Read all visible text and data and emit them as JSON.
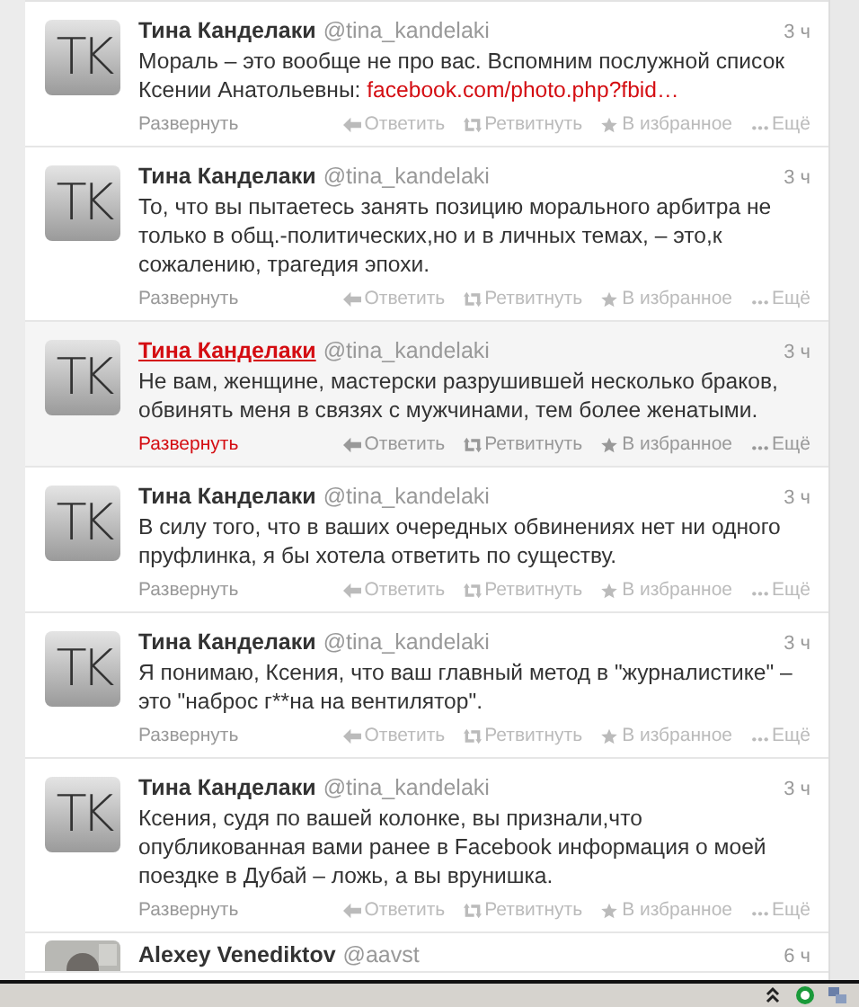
{
  "tweets": [
    {
      "kind": "logo",
      "avatar": "TK",
      "name": "Тина Канделаки",
      "handle": "@tina_kandelaki",
      "time": "3 ч",
      "text": "Мораль – это вообще не про вас. Вспомним послужной список Ксении Анатольевны: ",
      "link": "facebook.com/photo.php?fbid…",
      "expand": "Развернуть",
      "hovered": false,
      "actions": [
        "Ответить",
        "Ретвитнуть",
        "В избранное",
        "Ещё"
      ]
    },
    {
      "kind": "logo",
      "avatar": "TK",
      "name": "Тина Канделаки",
      "handle": "@tina_kandelaki",
      "time": "3 ч",
      "text": "То, что вы пытаетесь занять позицию морального арбитра не только в общ.-политических,но и в личных темах, – это,к сожалению, трагедия эпохи.",
      "expand": "Развернуть",
      "hovered": false,
      "actions": [
        "Ответить",
        "Ретвитнуть",
        "В избранное",
        "Ещё"
      ]
    },
    {
      "kind": "logo",
      "avatar": "TK",
      "name": "Тина Канделаки",
      "handle": "@tina_kandelaki",
      "time": "3 ч",
      "text": "Не вам, женщине, мастерски разрушившей несколько браков, обвинять меня в связях с мужчинами, тем более женатыми.",
      "expand": "Развернуть",
      "hovered": true,
      "actions": [
        "Ответить",
        "Ретвитнуть",
        "В избранное",
        "Ещё"
      ]
    },
    {
      "kind": "logo",
      "avatar": "TK",
      "name": "Тина Канделаки",
      "handle": "@tina_kandelaki",
      "time": "3 ч",
      "text": "В силу того, что в ваших очередных обвинениях нет ни одного пруфлинка, я бы хотела ответить по существу.",
      "expand": "Развернуть",
      "hovered": false,
      "actions": [
        "Ответить",
        "Ретвитнуть",
        "В избранное",
        "Ещё"
      ]
    },
    {
      "kind": "logo",
      "avatar": "TK",
      "name": "Тина Канделаки",
      "handle": "@tina_kandelaki",
      "time": "3 ч",
      "text": "Я понимаю, Ксения, что ваш главный метод в \"журналистике\" – это \"наброс г**на на вентилятор\".",
      "expand": "Развернуть",
      "hovered": false,
      "actions": [
        "Ответить",
        "Ретвитнуть",
        "В избранное",
        "Ещё"
      ]
    },
    {
      "kind": "logo",
      "avatar": "TK",
      "name": "Тина Канделаки",
      "handle": "@tina_kandelaki",
      "time": "3 ч",
      "text": "Ксения, судя по вашей колонке, вы признали,что опубликованная вами ранее в Facebook информация о моей поездке в Дубай – ложь, а вы врунишка.",
      "expand": "Развернуть",
      "hovered": false,
      "actions": [
        "Ответить",
        "Ретвитнуть",
        "В избранное",
        "Ещё"
      ]
    },
    {
      "kind": "picture",
      "name": "Alexey Venediktov",
      "handle": "@aavst",
      "time": "6 ч",
      "hovered": false
    }
  ]
}
